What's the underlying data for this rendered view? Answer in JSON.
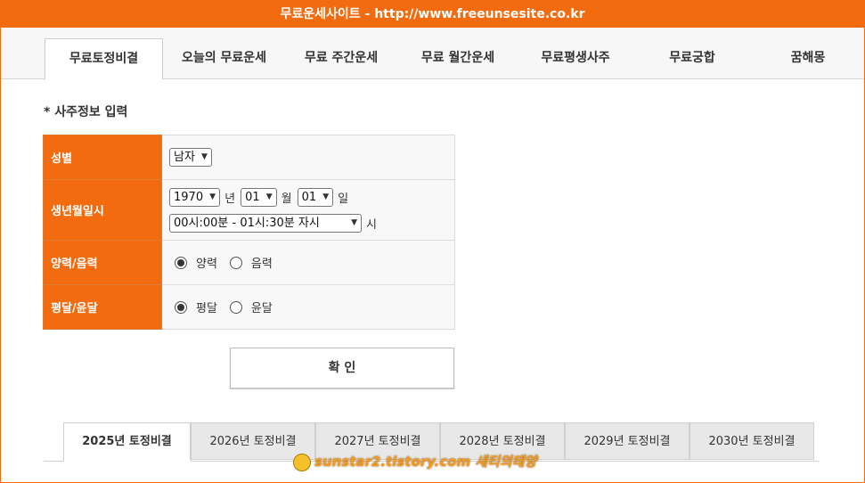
{
  "header": {
    "title": "무료운세사이트 - http://www.freeunsesite.co.kr"
  },
  "nav": {
    "tabs": [
      {
        "label": "무료토정비결",
        "active": true
      },
      {
        "label": "오늘의 무료운세"
      },
      {
        "label": "무료 주간운세"
      },
      {
        "label": "무료 월간운세"
      },
      {
        "label": "무료평생사주"
      },
      {
        "label": "무료궁합"
      },
      {
        "label": "꿈해몽"
      }
    ]
  },
  "form": {
    "section_title": "* 사주정보 입력",
    "gender": {
      "label": "성별",
      "value": "남자"
    },
    "birth": {
      "label": "생년월일시",
      "year": "1970",
      "year_unit": "년",
      "month": "01",
      "month_unit": "월",
      "day": "01",
      "day_unit": "일",
      "time": "00시:00분 - 01시:30분 자시",
      "time_unit": "시"
    },
    "calendar": {
      "label": "양력/음력",
      "options": [
        "양력",
        "음력"
      ],
      "selected": "양력"
    },
    "leap": {
      "label": "평달/윤달",
      "options": [
        "평달",
        "윤달"
      ],
      "selected": "평달"
    },
    "confirm_label": "확 인"
  },
  "year_tabs": [
    {
      "label": "2025년 토정비결",
      "active": true
    },
    {
      "label": "2026년 토정비결"
    },
    {
      "label": "2027년 토정비결"
    },
    {
      "label": "2028년 토정비결"
    },
    {
      "label": "2029년 토정비결"
    },
    {
      "label": "2030년 토정비결"
    }
  ],
  "watermark": {
    "text": "sunstar2.tistory.com 새티의태양"
  }
}
